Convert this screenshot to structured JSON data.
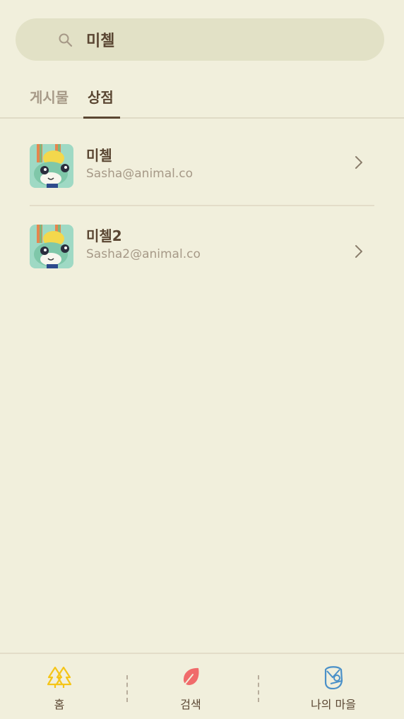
{
  "search": {
    "value": "미첼",
    "icon": "search-icon"
  },
  "tabs": [
    {
      "label": "게시물",
      "active": false
    },
    {
      "label": "상점",
      "active": true
    }
  ],
  "results": [
    {
      "title": "미첼",
      "subtitle": "Sasha@animal.co"
    },
    {
      "title": "미첼2",
      "subtitle": "Sasha2@animal.co"
    }
  ],
  "bottom_nav": {
    "home": {
      "label": "홈",
      "icon": "tree-icon",
      "color": "#f5c518"
    },
    "search": {
      "label": "검색",
      "icon": "leaf-icon",
      "color": "#f06b6b"
    },
    "mine": {
      "label": "나의 마을",
      "icon": "owl-icon",
      "color": "#4a90c8"
    }
  },
  "colors": {
    "background": "#f1efdc",
    "search_bg": "#e2e1c6",
    "text": "#5a4632",
    "muted": "#a69987"
  }
}
